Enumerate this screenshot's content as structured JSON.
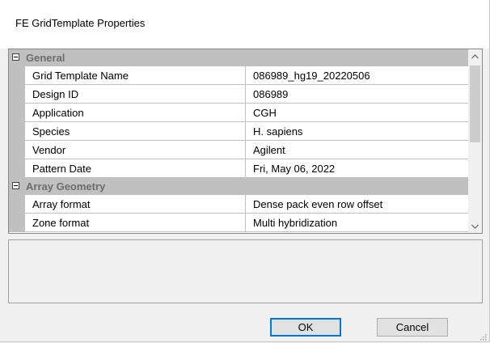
{
  "window": {
    "title": "FE GridTemplate Properties"
  },
  "grid": {
    "categories": [
      {
        "label": "General",
        "rows": [
          {
            "name": "Grid Template Name",
            "value": "086989_hg19_20220506"
          },
          {
            "name": "Design ID",
            "value": "086989"
          },
          {
            "name": "Application",
            "value": "CGH"
          },
          {
            "name": "Species",
            "value": "H. sapiens"
          },
          {
            "name": "Vendor",
            "value": "Agilent"
          },
          {
            "name": "Pattern Date",
            "value": "Fri, May 06, 2022"
          }
        ]
      },
      {
        "label": "Array Geometry",
        "rows": [
          {
            "name": "Array format",
            "value": "Dense pack even row offset"
          },
          {
            "name": "Zone format",
            "value": "Multi hybridization"
          }
        ]
      }
    ]
  },
  "buttons": {
    "ok_label": "OK",
    "cancel_label": "Cancel"
  },
  "colors": {
    "category_bg": "#c0c0c0",
    "focus_border": "#0078d7"
  },
  "icons": {
    "collapse": "minus-box-icon",
    "scroll_up": "chevron-up-icon",
    "scroll_down": "chevron-down-icon",
    "resize": "resize-grip-icon"
  }
}
